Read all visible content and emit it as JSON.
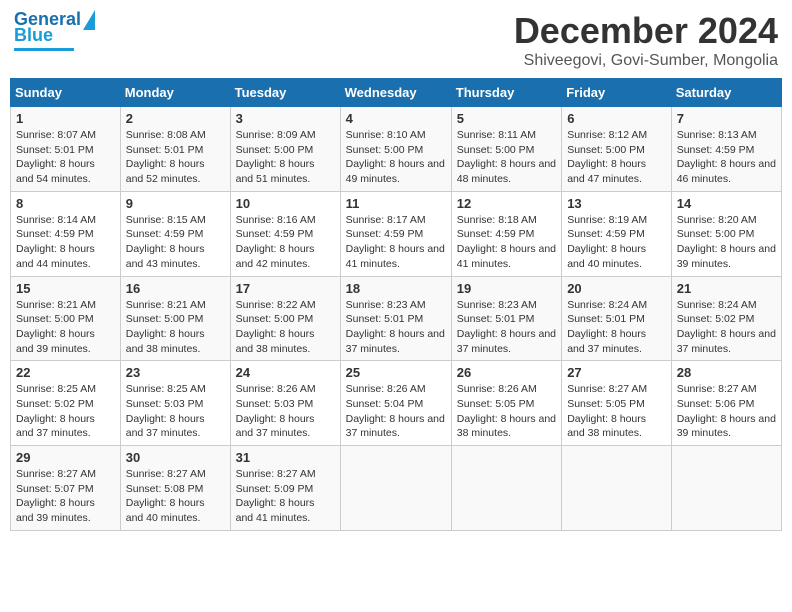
{
  "header": {
    "logo_line1": "General",
    "logo_line2": "Blue",
    "month": "December 2024",
    "location": "Shiveegovi, Govi-Sumber, Mongolia"
  },
  "weekdays": [
    "Sunday",
    "Monday",
    "Tuesday",
    "Wednesday",
    "Thursday",
    "Friday",
    "Saturday"
  ],
  "weeks": [
    [
      {
        "day": "1",
        "sunrise": "8:07 AM",
        "sunset": "5:01 PM",
        "daylight": "8 hours and 54 minutes."
      },
      {
        "day": "2",
        "sunrise": "8:08 AM",
        "sunset": "5:01 PM",
        "daylight": "8 hours and 52 minutes."
      },
      {
        "day": "3",
        "sunrise": "8:09 AM",
        "sunset": "5:00 PM",
        "daylight": "8 hours and 51 minutes."
      },
      {
        "day": "4",
        "sunrise": "8:10 AM",
        "sunset": "5:00 PM",
        "daylight": "8 hours and 49 minutes."
      },
      {
        "day": "5",
        "sunrise": "8:11 AM",
        "sunset": "5:00 PM",
        "daylight": "8 hours and 48 minutes."
      },
      {
        "day": "6",
        "sunrise": "8:12 AM",
        "sunset": "5:00 PM",
        "daylight": "8 hours and 47 minutes."
      },
      {
        "day": "7",
        "sunrise": "8:13 AM",
        "sunset": "4:59 PM",
        "daylight": "8 hours and 46 minutes."
      }
    ],
    [
      {
        "day": "8",
        "sunrise": "8:14 AM",
        "sunset": "4:59 PM",
        "daylight": "8 hours and 44 minutes."
      },
      {
        "day": "9",
        "sunrise": "8:15 AM",
        "sunset": "4:59 PM",
        "daylight": "8 hours and 43 minutes."
      },
      {
        "day": "10",
        "sunrise": "8:16 AM",
        "sunset": "4:59 PM",
        "daylight": "8 hours and 42 minutes."
      },
      {
        "day": "11",
        "sunrise": "8:17 AM",
        "sunset": "4:59 PM",
        "daylight": "8 hours and 41 minutes."
      },
      {
        "day": "12",
        "sunrise": "8:18 AM",
        "sunset": "4:59 PM",
        "daylight": "8 hours and 41 minutes."
      },
      {
        "day": "13",
        "sunrise": "8:19 AM",
        "sunset": "4:59 PM",
        "daylight": "8 hours and 40 minutes."
      },
      {
        "day": "14",
        "sunrise": "8:20 AM",
        "sunset": "5:00 PM",
        "daylight": "8 hours and 39 minutes."
      }
    ],
    [
      {
        "day": "15",
        "sunrise": "8:21 AM",
        "sunset": "5:00 PM",
        "daylight": "8 hours and 39 minutes."
      },
      {
        "day": "16",
        "sunrise": "8:21 AM",
        "sunset": "5:00 PM",
        "daylight": "8 hours and 38 minutes."
      },
      {
        "day": "17",
        "sunrise": "8:22 AM",
        "sunset": "5:00 PM",
        "daylight": "8 hours and 38 minutes."
      },
      {
        "day": "18",
        "sunrise": "8:23 AM",
        "sunset": "5:01 PM",
        "daylight": "8 hours and 37 minutes."
      },
      {
        "day": "19",
        "sunrise": "8:23 AM",
        "sunset": "5:01 PM",
        "daylight": "8 hours and 37 minutes."
      },
      {
        "day": "20",
        "sunrise": "8:24 AM",
        "sunset": "5:01 PM",
        "daylight": "8 hours and 37 minutes."
      },
      {
        "day": "21",
        "sunrise": "8:24 AM",
        "sunset": "5:02 PM",
        "daylight": "8 hours and 37 minutes."
      }
    ],
    [
      {
        "day": "22",
        "sunrise": "8:25 AM",
        "sunset": "5:02 PM",
        "daylight": "8 hours and 37 minutes."
      },
      {
        "day": "23",
        "sunrise": "8:25 AM",
        "sunset": "5:03 PM",
        "daylight": "8 hours and 37 minutes."
      },
      {
        "day": "24",
        "sunrise": "8:26 AM",
        "sunset": "5:03 PM",
        "daylight": "8 hours and 37 minutes."
      },
      {
        "day": "25",
        "sunrise": "8:26 AM",
        "sunset": "5:04 PM",
        "daylight": "8 hours and 37 minutes."
      },
      {
        "day": "26",
        "sunrise": "8:26 AM",
        "sunset": "5:05 PM",
        "daylight": "8 hours and 38 minutes."
      },
      {
        "day": "27",
        "sunrise": "8:27 AM",
        "sunset": "5:05 PM",
        "daylight": "8 hours and 38 minutes."
      },
      {
        "day": "28",
        "sunrise": "8:27 AM",
        "sunset": "5:06 PM",
        "daylight": "8 hours and 39 minutes."
      }
    ],
    [
      {
        "day": "29",
        "sunrise": "8:27 AM",
        "sunset": "5:07 PM",
        "daylight": "8 hours and 39 minutes."
      },
      {
        "day": "30",
        "sunrise": "8:27 AM",
        "sunset": "5:08 PM",
        "daylight": "8 hours and 40 minutes."
      },
      {
        "day": "31",
        "sunrise": "8:27 AM",
        "sunset": "5:09 PM",
        "daylight": "8 hours and 41 minutes."
      },
      null,
      null,
      null,
      null
    ]
  ]
}
